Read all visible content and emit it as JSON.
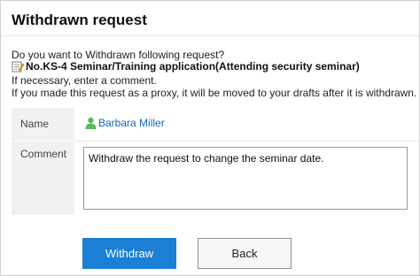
{
  "dialog": {
    "title": "Withdrawn request",
    "question": "Do you want to Withdrawn following request?",
    "request_name": "No.KS-4 Seminar/Training application(Attending security seminar)",
    "request_icon": "memo-icon",
    "hint": "If necessary, enter a comment.",
    "proxy_note": "If you made this request as a proxy, it will be moved to your drafts after it is withdrawn."
  },
  "form": {
    "name_label": "Name",
    "name_value": "Barbara Miller",
    "name_icon": "user-icon",
    "comment_label": "Comment",
    "comment_value": "Withdraw the request to change the seminar date."
  },
  "buttons": {
    "withdraw": "Withdraw",
    "back": "Back"
  },
  "colors": {
    "primary": "#1b7fd6",
    "link": "#1565c0",
    "label_bg": "#f1f1f1",
    "user_icon": "#5cb85c"
  }
}
